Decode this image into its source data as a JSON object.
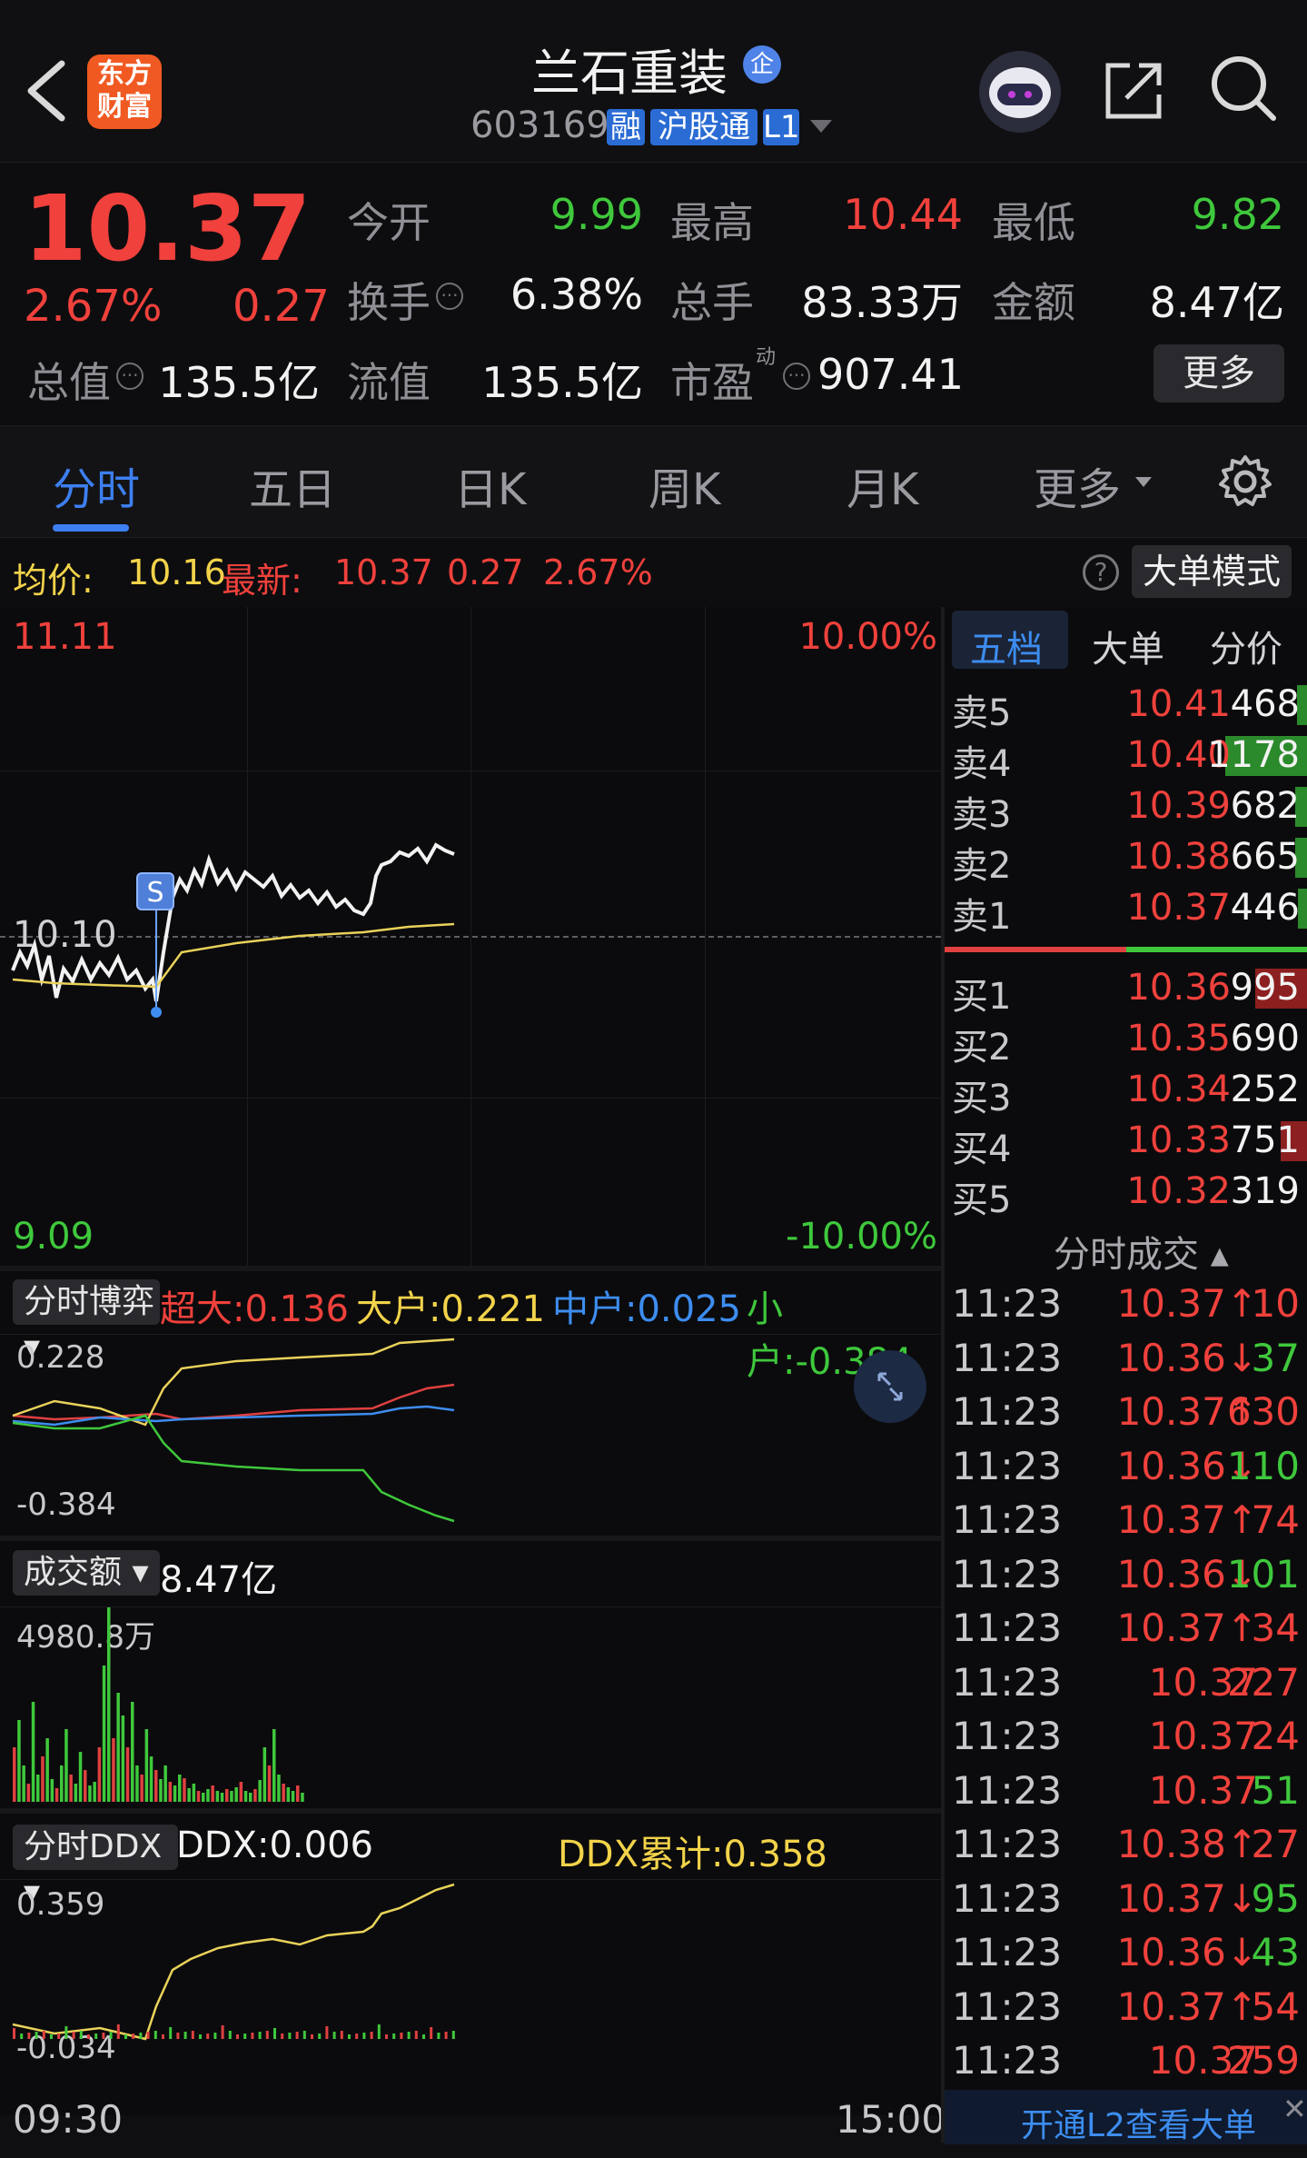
{
  "header": {
    "back_icon": "chevron-left-icon",
    "logo_line1": "东方",
    "logo_line2": "财富",
    "stock_name": "兰石重装",
    "enterprise_badge": "企",
    "stock_code": "603169",
    "tags": [
      "融",
      "沪股通",
      "L1"
    ],
    "share_icon": "share-icon",
    "search_icon": "search-icon"
  },
  "quote": {
    "price": "10.37",
    "change_pct": "2.67%",
    "change": "0.27",
    "fields": [
      {
        "label": "今开",
        "value": "9.99",
        "color": "#3fc83c"
      },
      {
        "label": "最高",
        "value": "10.44",
        "color": "#f0413c"
      },
      {
        "label": "最低",
        "value": "9.82",
        "color": "#3fc83c"
      },
      {
        "label": "换手",
        "value": "6.38%",
        "color": "#f2f2f2"
      },
      {
        "label": "总手",
        "value": "83.33万",
        "color": "#f2f2f2"
      },
      {
        "label": "金额",
        "value": "8.47亿",
        "color": "#f2f2f2"
      },
      {
        "label": "总值",
        "value": "135.5亿",
        "color": "#f2f2f2"
      },
      {
        "label": "流值",
        "value": "135.5亿",
        "color": "#f2f2f2"
      },
      {
        "label": "市盈",
        "value": "907.41",
        "color": "#f2f2f2"
      }
    ],
    "pe_superscript": "动",
    "more_button": "更多"
  },
  "tabs": [
    "分时",
    "五日",
    "日K",
    "周K",
    "月K",
    "更多"
  ],
  "info_bar": {
    "avg_label": "均价:",
    "avg_value": "10.16",
    "latest_label": "最新:",
    "latest_value": "10.37",
    "change": "0.27",
    "change_pct": "2.67%",
    "mode_button": "大单模式"
  },
  "price_chart": {
    "y_top": "11.11",
    "y_mid": "10.10",
    "y_bottom": "9.09",
    "pct_top": "10.00%",
    "pct_bottom": "-10.00%",
    "marker": "S"
  },
  "game_panel": {
    "dropdown": "分时博弈",
    "super": "超大:0.136",
    "large": "大户:0.221",
    "medium": "中户:0.025",
    "small": "小户:-0.384",
    "y_top": "0.228",
    "y_bottom": "-0.384"
  },
  "amount_panel": {
    "dropdown": "成交额",
    "value": "8.47亿",
    "y_top": "4980.8万"
  },
  "ddx_panel": {
    "dropdown": "分时DDX",
    "ddx": "DDX:0.006",
    "ddx_total": "DDX累计:0.358",
    "y_top": "0.359",
    "y_bottom": "-0.034"
  },
  "x_axis": {
    "start": "09:30",
    "end": "15:00"
  },
  "book_tabs": [
    "五档",
    "大单",
    "分价"
  ],
  "asks": [
    {
      "label": "卖5",
      "price": "10.41",
      "vol": "468",
      "bar": 0.12
    },
    {
      "label": "卖4",
      "price": "10.40",
      "vol": "1178",
      "bar": 0.95
    },
    {
      "label": "卖3",
      "price": "10.39",
      "vol": "682",
      "bar": 0.14
    },
    {
      "label": "卖2",
      "price": "10.38",
      "vol": "665",
      "bar": 0.14
    },
    {
      "label": "卖1",
      "price": "10.37",
      "vol": "446",
      "bar": 0.1
    }
  ],
  "book_balance": {
    "buy_ratio": 0.5
  },
  "bids": [
    {
      "label": "买1",
      "price": "10.36",
      "vol": "995",
      "bar": 0.6
    },
    {
      "label": "买2",
      "price": "10.35",
      "vol": "690",
      "bar": 0.0
    },
    {
      "label": "买3",
      "price": "10.34",
      "vol": "252",
      "bar": 0.0
    },
    {
      "label": "买4",
      "price": "10.33",
      "vol": "751",
      "bar": 0.3
    },
    {
      "label": "买5",
      "price": "10.32",
      "vol": "319",
      "bar": 0.0
    }
  ],
  "trades_header": "分时成交",
  "trades": [
    {
      "time": "11:23",
      "price": "10.37↑",
      "vol": "10",
      "dir": "up"
    },
    {
      "time": "11:23",
      "price": "10.36↓",
      "vol": "37",
      "dir": "down"
    },
    {
      "time": "11:23",
      "price": "10.37↑",
      "vol": "630",
      "dir": "up"
    },
    {
      "time": "11:23",
      "price": "10.36↓",
      "vol": "110",
      "dir": "down"
    },
    {
      "time": "11:23",
      "price": "10.37↑",
      "vol": "74",
      "dir": "up"
    },
    {
      "time": "11:23",
      "price": "10.36↓",
      "vol": "101",
      "dir": "down"
    },
    {
      "time": "11:23",
      "price": "10.37↑",
      "vol": "34",
      "dir": "up"
    },
    {
      "time": "11:23",
      "price": "10.37",
      "vol": "227",
      "dir": "up"
    },
    {
      "time": "11:23",
      "price": "10.37",
      "vol": "24",
      "dir": "up"
    },
    {
      "time": "11:23",
      "price": "10.37",
      "vol": "51",
      "dir": "down"
    },
    {
      "time": "11:23",
      "price": "10.38↑",
      "vol": "27",
      "dir": "up"
    },
    {
      "time": "11:23",
      "price": "10.37↓",
      "vol": "95",
      "dir": "down"
    },
    {
      "time": "11:23",
      "price": "10.36↓",
      "vol": "43",
      "dir": "down"
    },
    {
      "time": "11:23",
      "price": "10.37↑",
      "vol": "54",
      "dir": "up"
    },
    {
      "time": "11:23",
      "price": "10.37",
      "vol": "259",
      "dir": "up"
    }
  ],
  "l2_banner": "开通L2查看大单"
}
